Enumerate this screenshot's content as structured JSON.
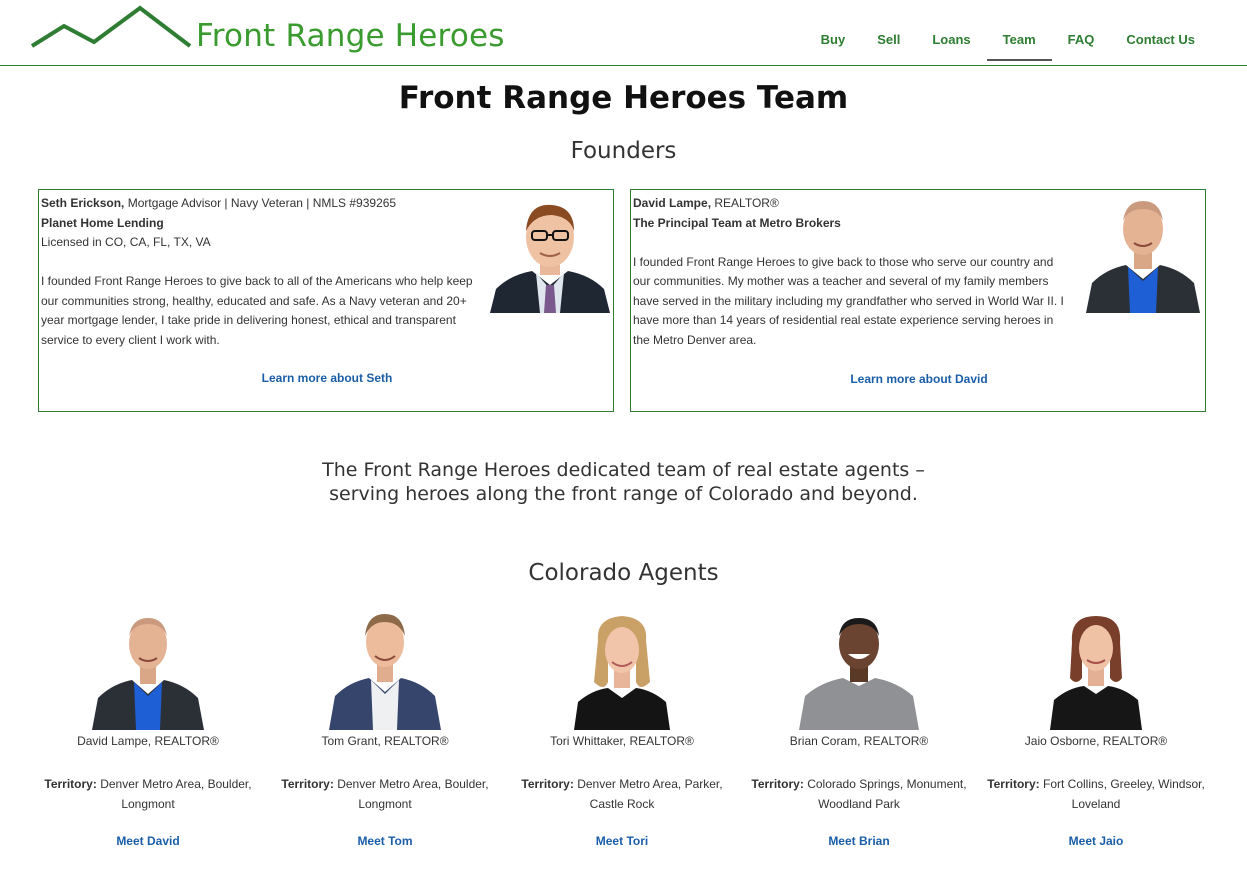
{
  "header": {
    "logo_text": "Front Range Heroes",
    "brand_color": "#3a9b2e",
    "nav": [
      {
        "label": "Buy"
      },
      {
        "label": "Sell"
      },
      {
        "label": "Loans"
      },
      {
        "label": "Team"
      },
      {
        "label": "FAQ"
      },
      {
        "label": "Contact Us"
      }
    ],
    "active_nav": "Team"
  },
  "page_title": "Front Range Heroes Team",
  "founders_title": "Founders",
  "founders": [
    {
      "name": "Seth Erickson,",
      "title_line": "Mortgage Advisor | Navy Veteran | NMLS #939265",
      "company": "Planet Home Lending",
      "licensed": "Licensed in CO, CA, FL, TX, VA",
      "bio": "I founded Front Range Heroes to give back to all of the Americans who help keep our communities strong, healthy, educated and safe. As a Navy veteran and 20+ year mortgage lender, I take pride in delivering honest, ethical and transparent service to every client I work with.",
      "link": "Learn more about Seth"
    },
    {
      "name": "David Lampe,",
      "title_line": "REALTOR®",
      "company": "The Principal Team at Metro Brokers",
      "bio": "I founded Front Range Heroes to give back to those who serve our country and our communities. My mother was a teacher and several of my family members have served in the military including my grandfather who served in World War II. I have more than 14 years of residential real estate experience serving heroes in the Metro Denver area.",
      "link": "Learn more about David"
    }
  ],
  "tagline_line1": "The Front Range Heroes dedicated team of real estate agents –",
  "tagline_line2": "serving heroes along the front range of Colorado and beyond.",
  "agents_title": "Colorado Agents",
  "territory_label": "Territory:",
  "agents": [
    {
      "name": "David Lampe, REALTOR®",
      "territory": "Denver Metro Area, Boulder, Longmont",
      "link": "Meet David"
    },
    {
      "name": "Tom Grant, REALTOR®",
      "territory": "Denver Metro Area, Boulder, Longmont",
      "link": "Meet Tom"
    },
    {
      "name": "Tori Whittaker, REALTOR®",
      "territory": "Denver Metro Area, Parker, Castle Rock",
      "link": "Meet Tori"
    },
    {
      "name": "Brian Coram, REALTOR®",
      "territory": "Colorado Springs, Monument, Woodland Park",
      "link": "Meet Brian"
    },
    {
      "name": "Jaio Osborne, REALTOR®",
      "territory": "Fort Collins, Greeley, Windsor, Loveland",
      "link": "Meet Jaio"
    }
  ]
}
